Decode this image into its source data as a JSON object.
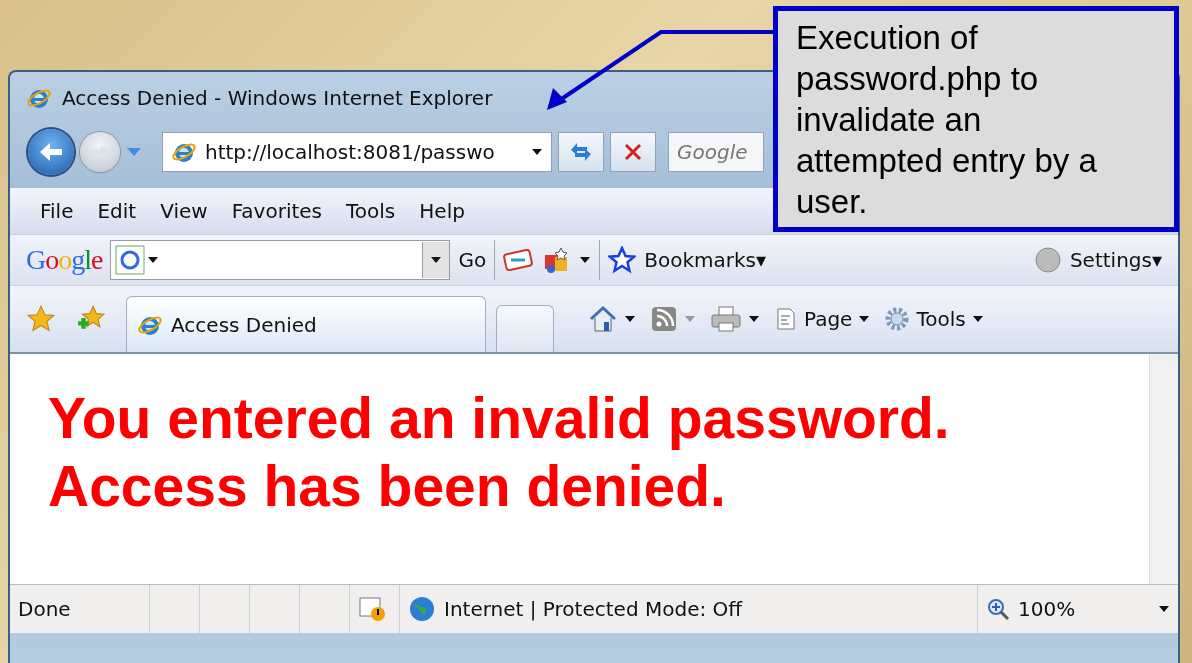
{
  "window": {
    "title": "Access Denied - Windows Internet Explorer"
  },
  "navigation": {
    "address": "http://localhost:8081/passwo",
    "search_placeholder": "Google"
  },
  "menu_bar": [
    "File",
    "Edit",
    "View",
    "Favorites",
    "Tools",
    "Help"
  ],
  "google_toolbar": {
    "logo": "Google",
    "go": "Go",
    "bookmarks": "Bookmarks▾",
    "settings": "Settings▾"
  },
  "tabs": [
    {
      "label": "Access Denied",
      "selected": true
    }
  ],
  "command_bar": [
    "Page",
    "Tools"
  ],
  "content": {
    "message_lines": [
      "You entered an invalid password.",
      "Access has been denied."
    ]
  },
  "status_bar": {
    "status": "Done",
    "zone": "Internet | Protected Mode: Off",
    "zoom": "100%"
  },
  "callout": {
    "text": "Execution of password.php to invalidate an attempted entry by a user."
  }
}
